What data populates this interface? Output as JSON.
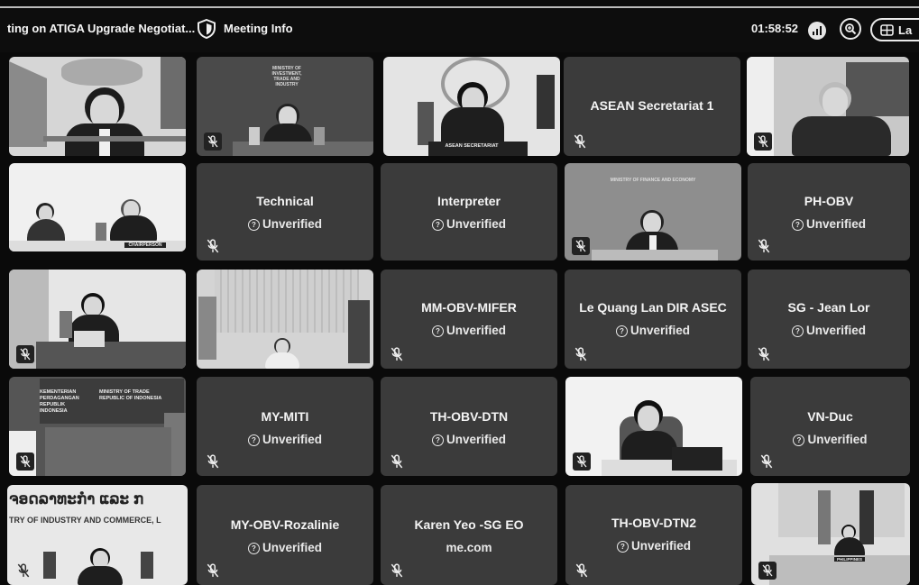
{
  "header": {
    "title": "ting on ATIGA Upgrade Negotiat...",
    "meeting_info": "Meeting Info",
    "timer": "01:58:52",
    "layout_label": "La"
  },
  "icons": {
    "shield": "shield-icon",
    "signal": "signal-strength-icon",
    "zoom": "zoom-icon",
    "layout": "layout-grid-icon",
    "mute": "microphone-muted-icon",
    "unverified": "question-circle-icon"
  },
  "tiles": [
    {
      "name": "",
      "status": ""
    },
    {
      "name": "",
      "status": "",
      "overlay": "MINISTRY OF INVESTMENT, TRADE AND INDUSTRY"
    },
    {
      "name": "",
      "status": "",
      "overlay": "ASEAN SECRETARIAT"
    },
    {
      "name": "ASEAN Secretariat 1",
      "status": ""
    },
    {
      "name": "",
      "status": ""
    },
    {
      "name": "",
      "status": "",
      "overlay": "CHAIRPERSON"
    },
    {
      "name": "Technical",
      "status": "Unverified"
    },
    {
      "name": "Interpreter",
      "status": "Unverified"
    },
    {
      "name": "",
      "status": "",
      "overlay": "MINISTRY OF FINANCE AND ECONOMY"
    },
    {
      "name": "PH-OBV",
      "status": "Unverified"
    },
    {
      "name": "",
      "status": ""
    },
    {
      "name": "",
      "status": ""
    },
    {
      "name": "MM-OBV-MIFER",
      "status": "Unverified"
    },
    {
      "name": "Le Quang Lan DIR ASEC",
      "status": "Unverified"
    },
    {
      "name": "SG - Jean Lor",
      "status": "Unverified"
    },
    {
      "name": "",
      "status": "",
      "overlay1": "KEMENTERIAN PERDAGANGAN REPUBLIK INDONESIA",
      "overlay2": "MINISTRY OF TRADE REPUBLIC OF INDONESIA"
    },
    {
      "name": "MY-MITI",
      "status": "Unverified"
    },
    {
      "name": "TH-OBV-DTN",
      "status": "Unverified"
    },
    {
      "name": "",
      "status": ""
    },
    {
      "name": "VN-Duc",
      "status": "Unverified"
    },
    {
      "name": "",
      "status": "",
      "overlay1": "ຈອດລາທະກຳ ແລະ ກ",
      "overlay2": "TRY OF INDUSTRY AND COMMERCE, L"
    },
    {
      "name": "MY-OBV-Rozalinie",
      "status": "Unverified"
    },
    {
      "name": "Karen Yeo -SG EO",
      "status": "me.com"
    },
    {
      "name": "TH-OBV-DTN2",
      "status": "Unverified"
    },
    {
      "name": "",
      "status": "",
      "overlay": "PHILIPPINES"
    }
  ],
  "colors": {
    "background": "#0a0a0a",
    "tile": "#3b3b3b",
    "text": "#f4f4f4"
  }
}
